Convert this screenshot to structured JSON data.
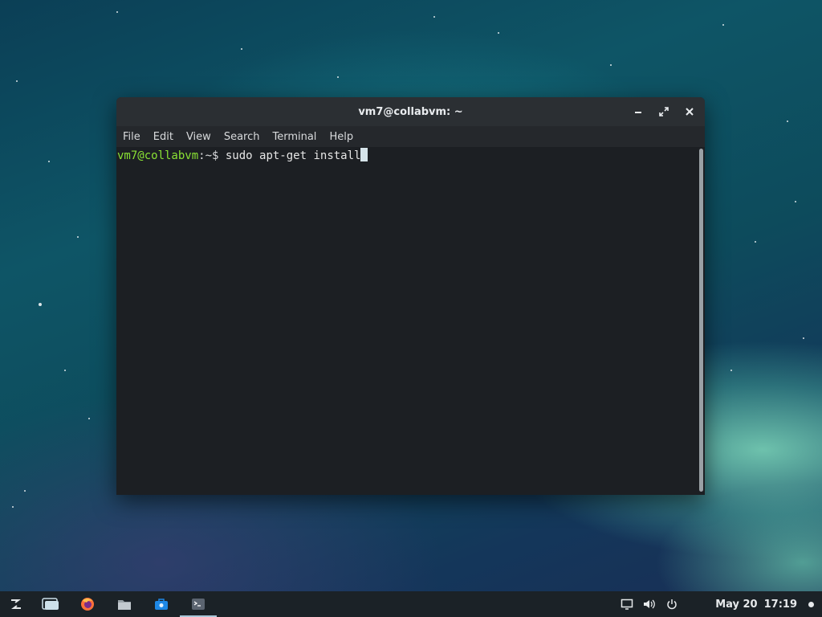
{
  "window": {
    "title": "vm7@collabvm: ~",
    "menu": [
      "File",
      "Edit",
      "View",
      "Search",
      "Terminal",
      "Help"
    ]
  },
  "terminal": {
    "prompt_user": "vm7@collabvm",
    "prompt_path": ":~$",
    "command": " sudo apt-get install"
  },
  "taskbar": {
    "launchers": [
      "zorin-menu-icon",
      "workspaces-icon",
      "firefox-icon",
      "files-icon",
      "software-store-icon",
      "terminal-icon"
    ],
    "tray": [
      "screen-icon",
      "volume-icon",
      "power-icon"
    ],
    "date": "May 20",
    "time": "17:19"
  },
  "colors": {
    "prompt_user": "#8ae234",
    "terminal_bg": "#1c1f23",
    "taskbar_bg": "#1b2227"
  }
}
